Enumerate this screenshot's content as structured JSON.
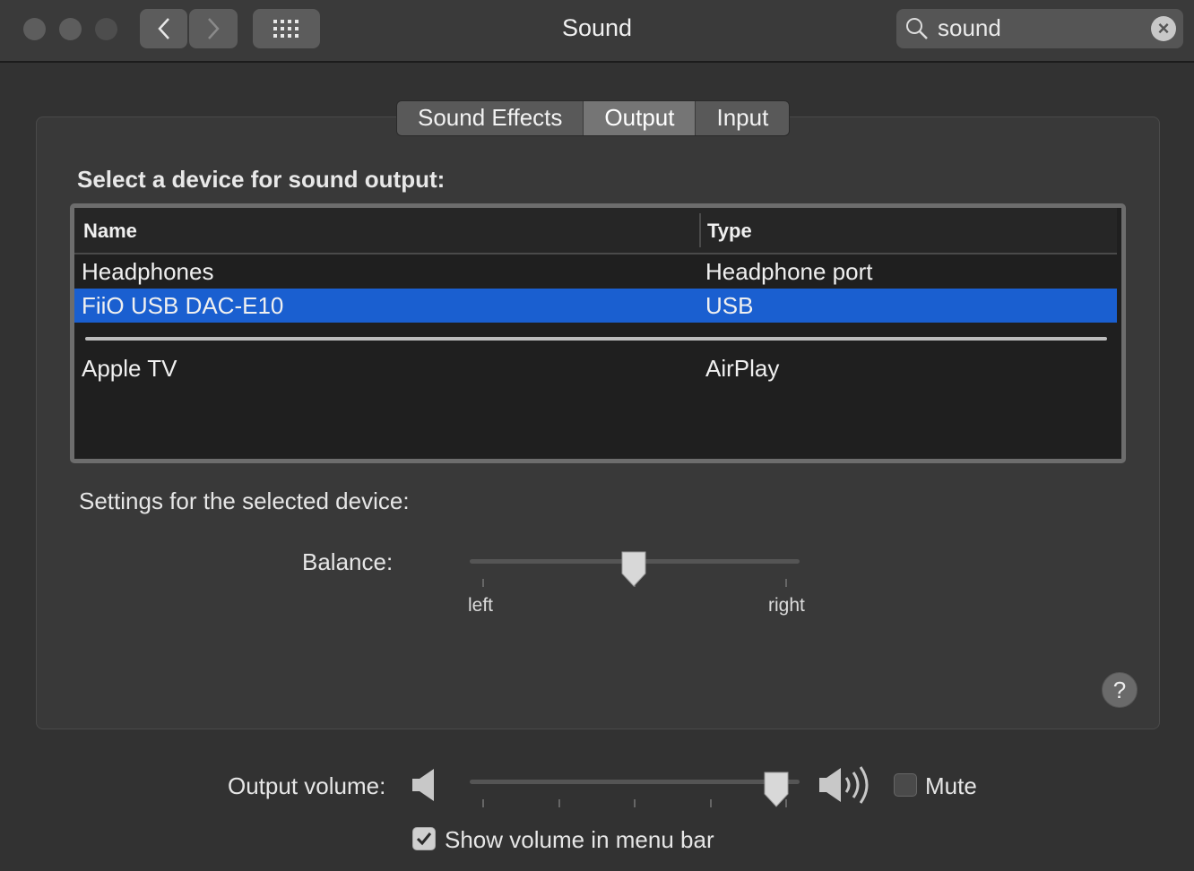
{
  "window": {
    "title": "Sound"
  },
  "toolbar": {
    "back_icon": "chevron-left-icon",
    "forward_icon": "chevron-right-icon",
    "grid_icon": "grid-icon"
  },
  "search": {
    "value": "sound",
    "placeholder": "Search"
  },
  "tabs": [
    {
      "label": "Sound Effects",
      "active": false
    },
    {
      "label": "Output",
      "active": true
    },
    {
      "label": "Input",
      "active": false
    }
  ],
  "main": {
    "heading": "Select a device for sound output:",
    "columns": [
      "Name",
      "Type"
    ],
    "devices": [
      {
        "name": "Headphones",
        "type": "Headphone port",
        "selected": false
      },
      {
        "name": "FiiO USB DAC-E10",
        "type": "USB",
        "selected": true
      },
      {
        "name": "Apple TV",
        "type": "AirPlay",
        "selected": false
      }
    ],
    "settings_label": "Settings for the selected device:",
    "balance": {
      "label": "Balance:",
      "left_label": "left",
      "right_label": "right",
      "value": 0.5
    }
  },
  "footer": {
    "output_volume_label": "Output volume:",
    "volume_level": 0.97,
    "mute_label": "Mute",
    "mute_checked": false,
    "show_volume_label": "Show volume in menu bar",
    "show_volume_checked": true
  },
  "colors": {
    "selection": "#1a5fd0",
    "background": "#323232"
  }
}
